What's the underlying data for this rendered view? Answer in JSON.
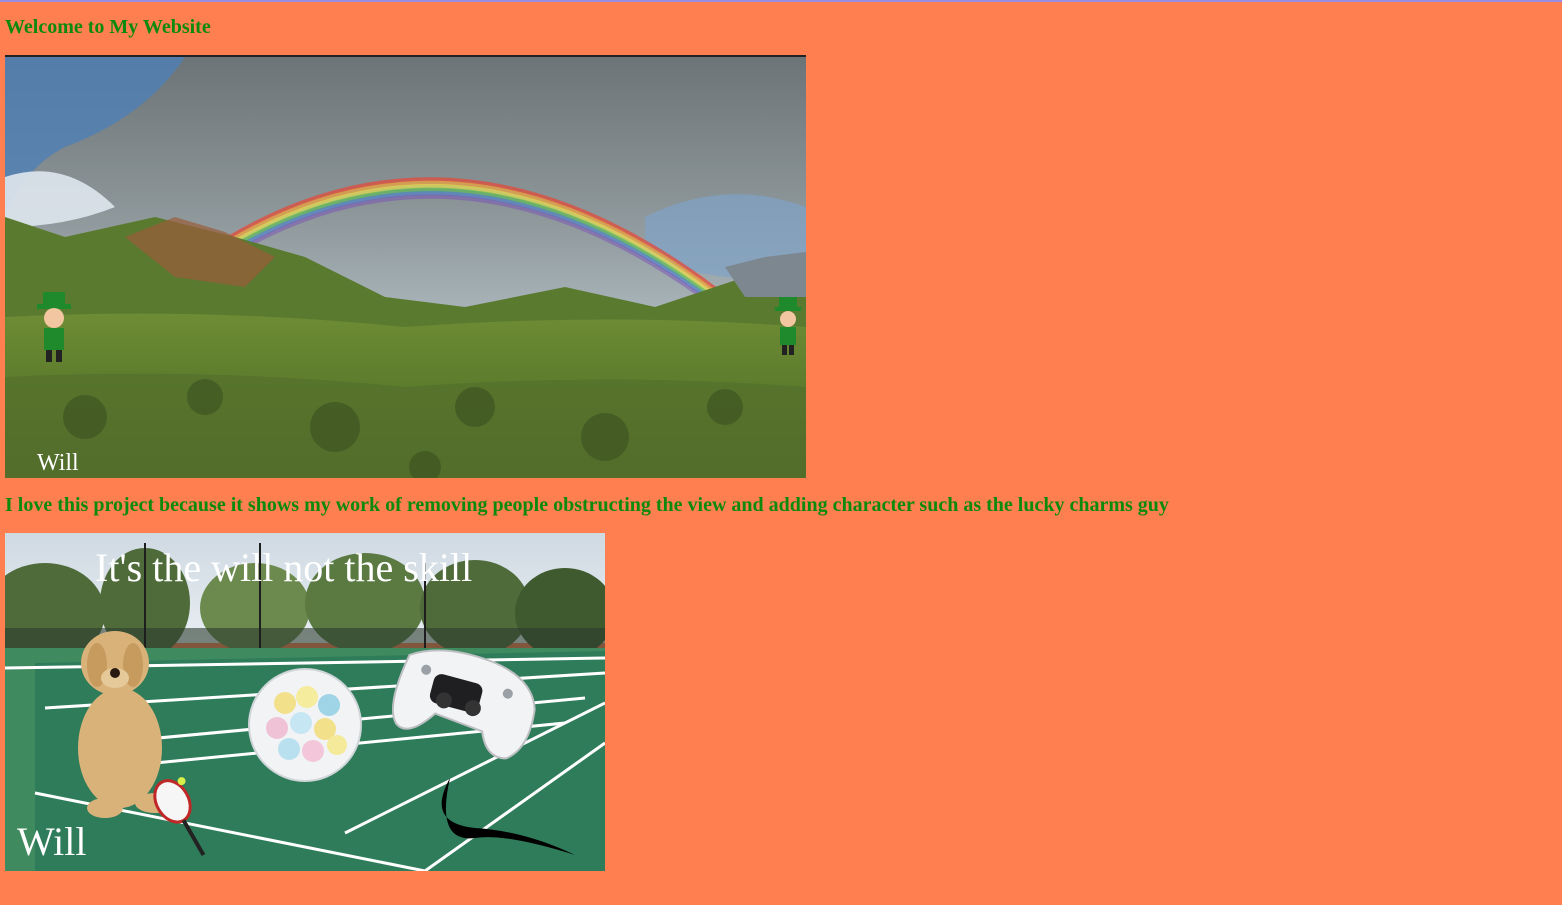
{
  "page": {
    "title": "Welcome to My Website",
    "caption": "I love this project because it shows my work of removing people obstructing the view and adding character such as the lucky charms guy"
  },
  "photo1": {
    "watermark": "Will"
  },
  "photo2": {
    "headline": "It's the will not the skill",
    "watermark": "Will"
  },
  "colors": {
    "background": "#ff7f50",
    "heading_text": "#0d8a0d"
  }
}
